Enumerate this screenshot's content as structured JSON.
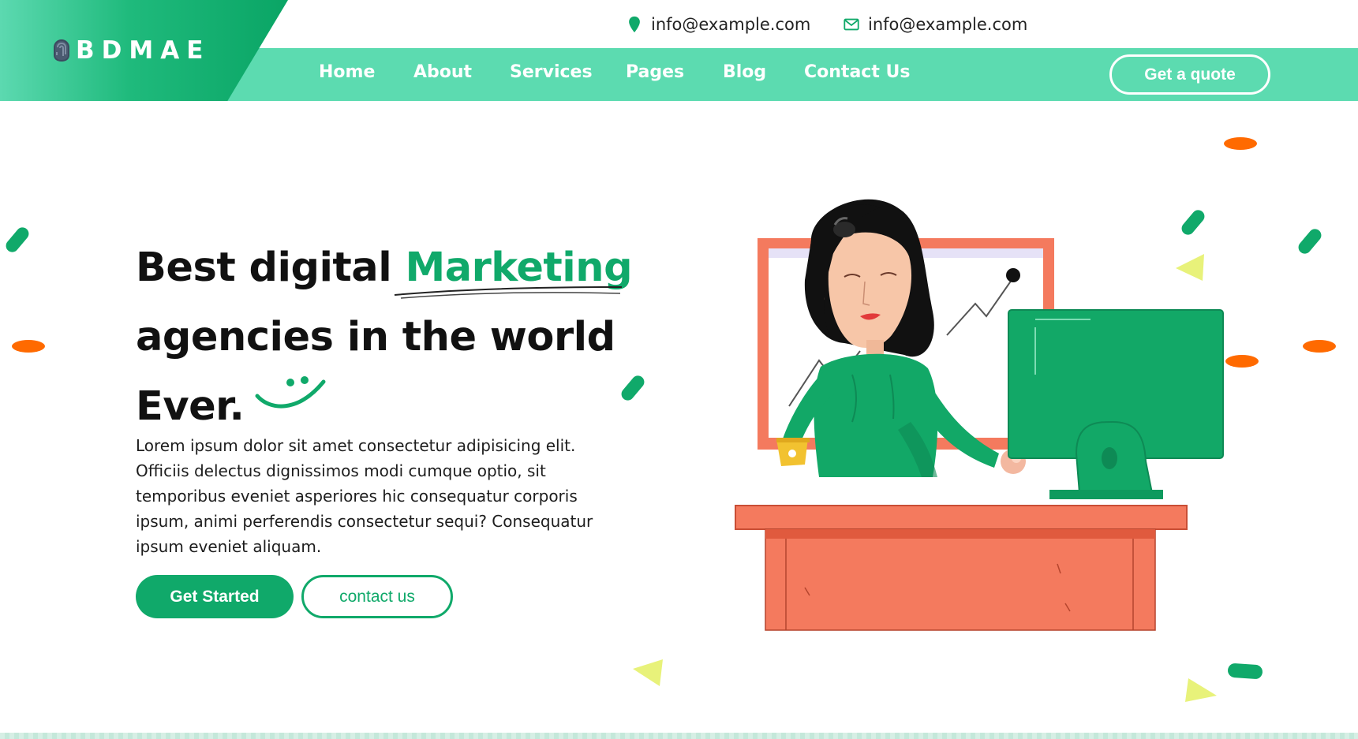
{
  "brand": {
    "name": "BDMAE",
    "logo_icon": "fingerprint-icon"
  },
  "contacts": [
    {
      "icon": "map-pin-icon",
      "text": "info@example.com"
    },
    {
      "icon": "envelope-icon",
      "text": "info@example.com"
    }
  ],
  "nav": {
    "items": [
      "Home",
      "About",
      "Services",
      "Pages",
      "Blog",
      "Contact Us"
    ],
    "quote_label": "Get a quote"
  },
  "hero": {
    "title_part1": "Best digital ",
    "title_accent": "Marketing",
    "title_line2": "agencies in the world",
    "title_line3": "Ever.",
    "description": "Lorem ipsum dolor sit amet consectetur adipisicing elit. Officiis delectus dignissimos modi cumque optio, sit temporibus eveniet asperiores hic consequatur corporis ipsum, animi perferendis consectetur sequi? Consequatur ipsum eveniet aliquam.",
    "primary_button": "Get Started",
    "secondary_button": "contact us"
  },
  "colors": {
    "primary": "#10a96a",
    "nav_band": "#5cdbb0",
    "accent_orange": "#ff6a00",
    "accent_yellow": "#e8f27a",
    "desk": "#f47a5e"
  }
}
